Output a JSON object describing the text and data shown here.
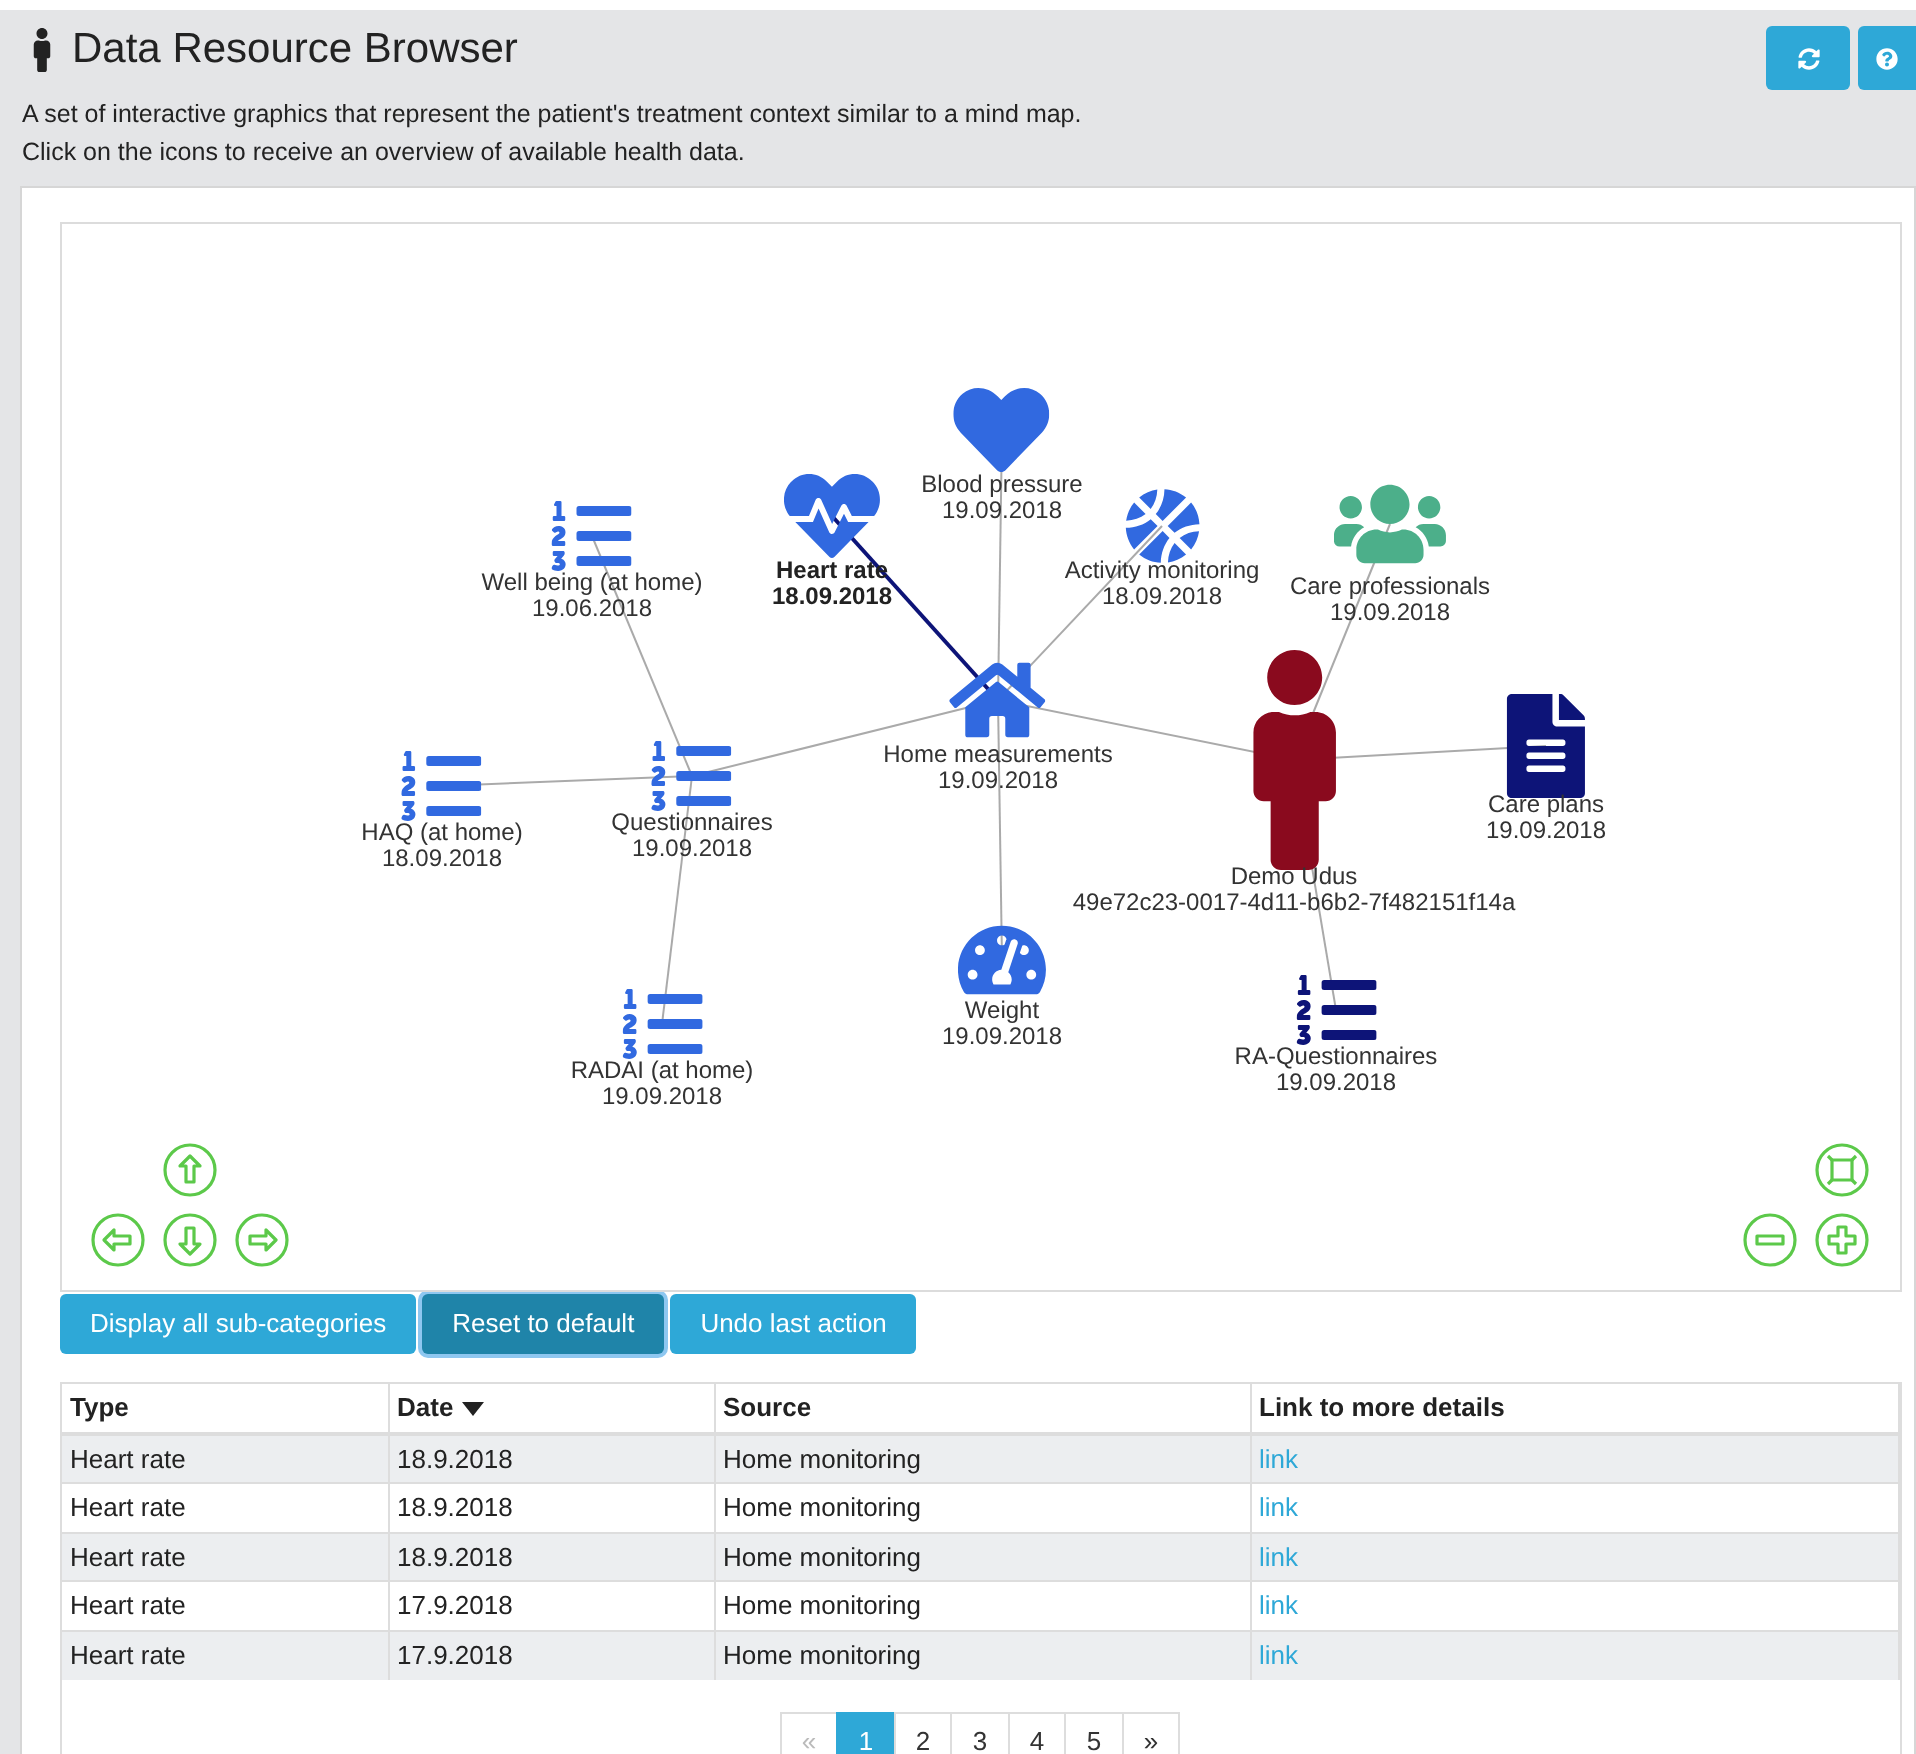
{
  "header": {
    "title": "Data Resource Browser",
    "description": [
      "A set of interactive graphics that represent the patient's treatment context similar to a mind map.",
      "Click on the icons to receive an overview of available health data."
    ]
  },
  "mind_map": {
    "nodes": [
      {
        "kind": "list",
        "label": "Well being (at home)",
        "date": "19.06.2018",
        "selected": false,
        "color": "#3169e0"
      },
      {
        "kind": "heartbeat",
        "label": "Heart rate",
        "date": "18.09.2018",
        "selected": true,
        "color": "#3169e0"
      },
      {
        "kind": "heart",
        "label": "Blood pressure",
        "date": "19.09.2018",
        "selected": false,
        "color": "#3169e0"
      },
      {
        "kind": "ball",
        "label": "Activity monitoring",
        "date": "18.09.2018",
        "selected": false,
        "color": "#3169e0"
      },
      {
        "kind": "group",
        "label": "Care professionals",
        "date": "19.09.2018",
        "selected": false,
        "color": "#4caf8a"
      },
      {
        "kind": "list",
        "label": "HAQ (at home)",
        "date": "18.09.2018",
        "selected": false,
        "color": "#3169e0"
      },
      {
        "kind": "list",
        "label": "Questionnaires",
        "date": "19.09.2018",
        "selected": false,
        "color": "#3169e0"
      },
      {
        "kind": "home",
        "label": "Home measurements",
        "date": "19.09.2018",
        "selected": false,
        "color": "#3169e0"
      },
      {
        "kind": "person",
        "label": "Demo Udus",
        "date": "49e72c23-0017-4d11-b6b2-7f482151f14a",
        "selected": false,
        "color": "#8a0a1e"
      },
      {
        "kind": "document",
        "label": "Care plans",
        "date": "19.09.2018",
        "selected": false,
        "color": "#0d1478"
      },
      {
        "kind": "list",
        "label": "RADAI (at home)",
        "date": "19.09.2018",
        "selected": false,
        "color": "#3169e0"
      },
      {
        "kind": "gauge",
        "label": "Weight",
        "date": "19.09.2018",
        "selected": false,
        "color": "#3169e0"
      },
      {
        "kind": "list",
        "label": "RA-Questionnaires",
        "date": "19.09.2018",
        "selected": false,
        "color": "#0d1478"
      }
    ]
  },
  "actions": [
    {
      "label": "Display all sub-categories",
      "selected": false
    },
    {
      "label": "Reset to default",
      "selected": true
    },
    {
      "label": "Undo last action",
      "selected": false
    }
  ],
  "table": {
    "columns": [
      {
        "label": "Type",
        "sorted": false
      },
      {
        "label": "Date",
        "sorted": true
      },
      {
        "label": "Source",
        "sorted": false
      },
      {
        "label": "Link to more details",
        "sorted": false
      }
    ],
    "rows": [
      [
        "Heart rate",
        "18.9.2018",
        "Home monitoring",
        "link"
      ],
      [
        "Heart rate",
        "18.9.2018",
        "Home monitoring",
        "link"
      ],
      [
        "Heart rate",
        "18.9.2018",
        "Home monitoring",
        "link"
      ],
      [
        "Heart rate",
        "17.9.2018",
        "Home monitoring",
        "link"
      ],
      [
        "Heart rate",
        "17.9.2018",
        "Home monitoring",
        "link"
      ]
    ]
  },
  "pagination": [
    {
      "label": "«",
      "selected": false,
      "disabled": true
    },
    {
      "label": "1",
      "selected": true,
      "disabled": false
    },
    {
      "label": "2",
      "selected": false,
      "disabled": false
    },
    {
      "label": "3",
      "selected": false,
      "disabled": false
    },
    {
      "label": "4",
      "selected": false,
      "disabled": false
    },
    {
      "label": "5",
      "selected": false,
      "disabled": false
    },
    {
      "label": "»",
      "selected": false,
      "disabled": false
    }
  ]
}
